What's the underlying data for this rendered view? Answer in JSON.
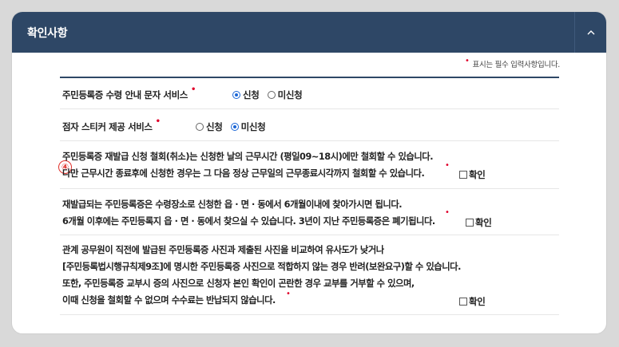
{
  "header": {
    "title": "확인사항",
    "toggle_icon": "chevron-up-icon"
  },
  "required_note": {
    "marker": "•",
    "text": "표시는 필수 입력사항입니다."
  },
  "step_badge": "④",
  "fields": [
    {
      "label": "주민등록증 수령 안내 문자 서비스",
      "required": true,
      "options": [
        {
          "label": "신청",
          "checked": true
        },
        {
          "label": "미신청",
          "checked": false
        }
      ]
    },
    {
      "label": "점자 스티커 제공 서비스",
      "required": true,
      "options": [
        {
          "label": "신청",
          "checked": false
        },
        {
          "label": "미신청",
          "checked": true
        }
      ]
    }
  ],
  "notices": [
    {
      "lines": [
        "주민등록증 재발급 신청 철회(취소)는 신청한 날의 근무시간 (평일09~18시)에만 철회할 수 있습니다.",
        "다만 근무시간 종료후에 신청한 경우는 그 다음 정상 근무일의 근무종료시각까지 철회할 수 있습니다."
      ],
      "confirm_label": "확인",
      "checked": false
    },
    {
      "lines": [
        "재발급되는 주민등록증은 수령장소로 신청한 읍 · 면 · 동에서 6개월이내에 찾아가시면 됩니다.",
        "6개월 이후에는 주민등록지 읍 · 면 · 동에서 찾으실 수 있습니다. 3년이 지난 주민등록증은 폐기됩니다."
      ],
      "confirm_label": "확인",
      "checked": false
    },
    {
      "lines": [
        "관계 공무원이 직전에 발급된 주민등록증 사진과 제출된 사진을 비교하여 유사도가 낮거나",
        "[주민등록법시행규칙제9조]에 명시한 주민등록증 사진으로 적합하지 않는 경우 반려(보완요구)할 수 있습니다.",
        "또한, 주민등록증 교부시 증의 사진으로 신청자 본인 확인이 곤란한 경우 교부를 거부할 수 있으며,",
        "이때 신청을 철회할 수 없으며 수수료는 반납되지 않습니다."
      ],
      "confirm_label": "확인",
      "checked": false
    }
  ],
  "colors": {
    "header_bg": "#2e4766",
    "required": "#e0002a",
    "radio_on": "#1a66d6",
    "step_badge": "#e0302a"
  }
}
